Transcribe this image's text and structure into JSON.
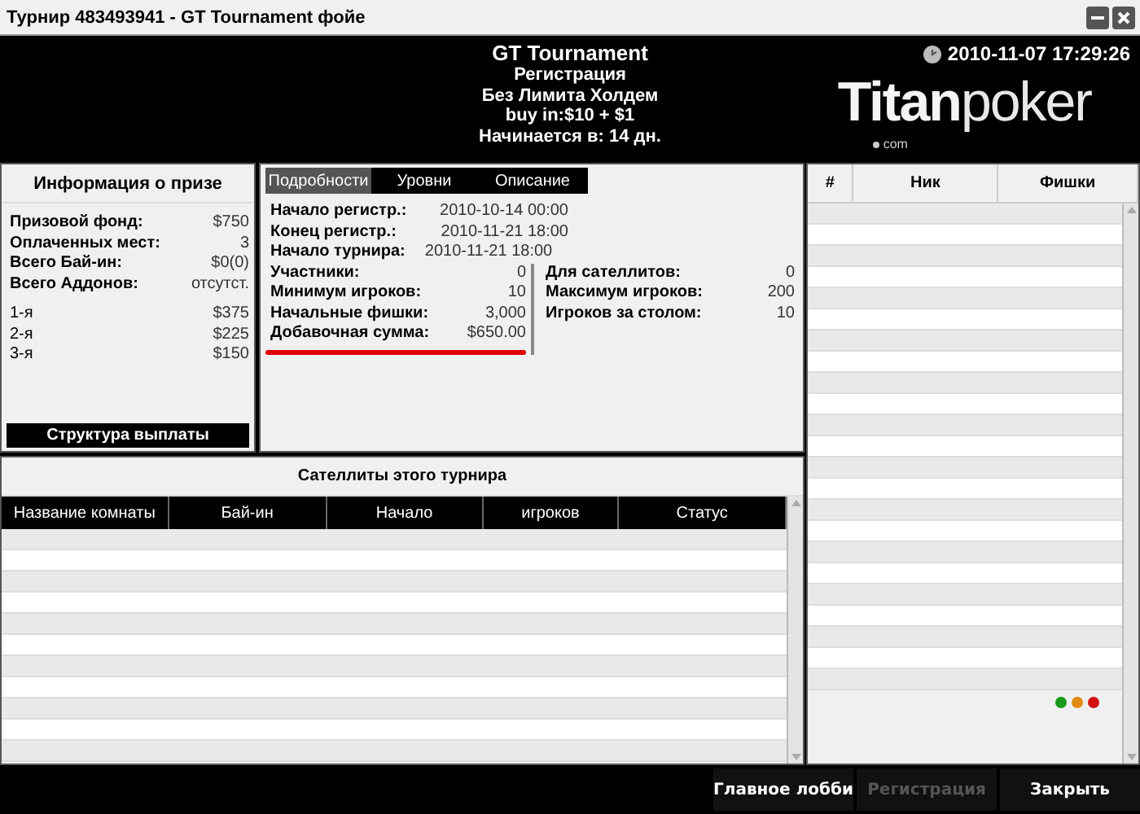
{
  "window": {
    "title": "Турнир 483493941 - GT Tournament фойе"
  },
  "header": {
    "lines": [
      "GT Tournament",
      "Регистрация",
      "Без Лимита Холдем",
      "buy in:$10 + $1",
      "Начинается в: 14 дн."
    ],
    "datetime": "2010-11-07 17:29:26",
    "logo": {
      "main": "Titan",
      "sub": "poker",
      "domain": "com"
    }
  },
  "prize": {
    "title": "Информация о призе",
    "rows": [
      {
        "label": "Призовой фонд:",
        "value": "$750"
      },
      {
        "label": "Оплаченных мест:",
        "value": "3"
      },
      {
        "label": "Всего Бай-ин:",
        "value": "$0(0)"
      },
      {
        "label": "Всего Аддонов:",
        "value": "отсутст."
      }
    ],
    "places": [
      {
        "label": "1-я",
        "value": "$375"
      },
      {
        "label": "2-я",
        "value": "$225"
      },
      {
        "label": "3-я",
        "value": "$150"
      }
    ],
    "button": "Структура выплаты"
  },
  "details": {
    "tabs": [
      {
        "label": "Подробности",
        "selected": true
      },
      {
        "label": "Уровни",
        "selected": false
      },
      {
        "label": "Описание",
        "selected": false
      }
    ],
    "dates": [
      {
        "label": "Начало регистр.:",
        "value": "2010-10-14 00:00",
        "kind": "aligned"
      },
      {
        "label": "Конец регистр.:",
        "value": "2010-11-21 18:00",
        "kind": "aligned"
      },
      {
        "label": "Начало турнира:",
        "value": "2010-11-21 18:00",
        "kind": "inline"
      }
    ],
    "left": [
      {
        "label": "Участники:",
        "value": "0",
        "highlighted": false
      },
      {
        "label": "Минимум игроков:",
        "value": "10",
        "highlighted": false
      },
      {
        "label": "Начальные фишки:",
        "value": "3,000",
        "highlighted": false
      },
      {
        "label": "Добавочная сумма:",
        "value": "$650.00",
        "highlighted": true
      }
    ],
    "right": [
      {
        "label": "Для сателлитов:",
        "value": "0"
      },
      {
        "label": "Максимум игроков:",
        "value": "200"
      },
      {
        "label": "Игроков за столом:",
        "value": "10"
      }
    ]
  },
  "satellites": {
    "title": "Сателлиты этого турнира",
    "columns": [
      "Название комнаты",
      "Бай-ин",
      "Начало",
      "игроков",
      "Статус"
    ]
  },
  "players": {
    "columns": [
      "#",
      "Ник",
      "Фишки"
    ]
  },
  "buttons": [
    {
      "label": "Главное лобби",
      "disabled": false
    },
    {
      "label": "Регистрация",
      "disabled": true
    },
    {
      "label": "Закрыть",
      "disabled": false
    }
  ]
}
